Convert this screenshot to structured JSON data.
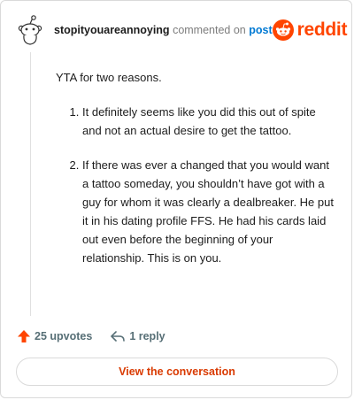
{
  "header": {
    "username": "stopityouareannoying",
    "action_text": "commented on",
    "post_link": "post",
    "brand": "reddit"
  },
  "comment": {
    "intro": "YTA for two reasons.",
    "points": [
      "It definitely seems like you did this out of spite and not an actual desire to get the tattoo.",
      "If there was ever a changed that you would want a tattoo someday, you shouldn’t have got with a guy for whom it was clearly a dealbreaker. He put it in his dating profile FFS. He had his cards laid out even before the beginning of your relationship. This is on you."
    ]
  },
  "footer": {
    "upvotes": "25 upvotes",
    "replies": "1 reply"
  },
  "cta_label": "View the conversation",
  "colors": {
    "brand": "#ff4500",
    "link": "#0079d3",
    "cta_text": "#d93a00",
    "muted": "#576f76"
  },
  "icons": [
    "snoo-avatar-icon",
    "reddit-logo-icon",
    "upvote-arrow-icon",
    "reply-arrow-icon"
  ]
}
